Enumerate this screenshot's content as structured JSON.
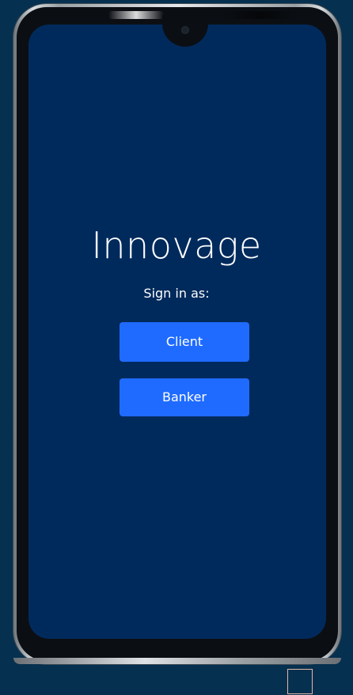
{
  "app": {
    "title": "Innovage",
    "subtitle": "Sign in as:"
  },
  "buttons": {
    "client_label": "Client",
    "banker_label": "Banker"
  },
  "colors": {
    "page_background": "#06304f",
    "screen_background": "#012a5c",
    "button_background": "#1f6bff",
    "text": "#ffffff"
  }
}
